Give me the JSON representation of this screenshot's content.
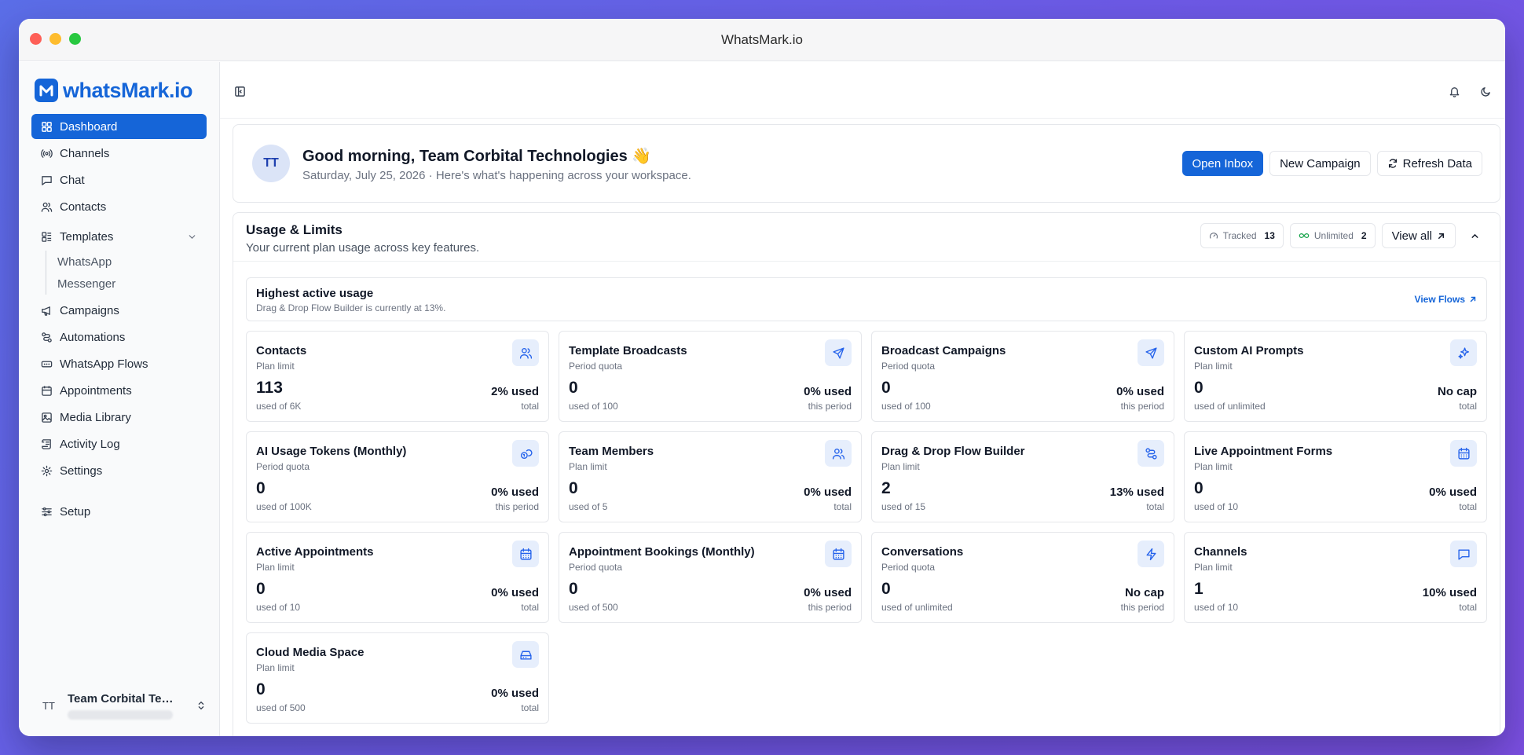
{
  "window": {
    "title": "WhatsMark.io"
  },
  "brand": {
    "name": "whatsMark.io",
    "color": "#1565d8"
  },
  "sidebar": {
    "items": [
      {
        "label": "Dashboard",
        "icon": "grid-icon",
        "active": true
      },
      {
        "label": "Channels",
        "icon": "radio-icon"
      },
      {
        "label": "Chat",
        "icon": "message-icon"
      },
      {
        "label": "Contacts",
        "icon": "users-icon"
      },
      {
        "label": "Templates",
        "icon": "template-icon"
      },
      {
        "label": "Campaigns",
        "icon": "megaphone-icon"
      },
      {
        "label": "Automations",
        "icon": "route-icon"
      },
      {
        "label": "WhatsApp Flows",
        "icon": "rectangle-ellipsis-icon"
      },
      {
        "label": "Appointments",
        "icon": "calendar-icon"
      },
      {
        "label": "Media Library",
        "icon": "image-icon"
      },
      {
        "label": "Activity Log",
        "icon": "scroll-icon"
      },
      {
        "label": "Settings",
        "icon": "gear-icon"
      },
      {
        "label": "Setup",
        "icon": "sliders-icon"
      }
    ],
    "templates_sub": [
      "WhatsApp",
      "Messenger"
    ],
    "user": {
      "initials": "TT",
      "name": "Team Corbital Tec..."
    }
  },
  "greeting": {
    "initials": "TT",
    "title": "Good morning, Team Corbital Technologies 👋",
    "subtitle": "Saturday, July 25, 2026 · Here's what's happening across your workspace.",
    "buttons": {
      "open_inbox": "Open Inbox",
      "new_campaign": "New Campaign",
      "refresh": "Refresh Data"
    }
  },
  "usage": {
    "title": "Usage & Limits",
    "subtitle": "Your current plan usage across key features.",
    "tracked_label": "Tracked",
    "tracked_count": "13",
    "unlimited_label": "Unlimited",
    "unlimited_count": "2",
    "view_all": "View all",
    "highest": {
      "title": "Highest active usage",
      "subtitle": "Drag & Drop Flow Builder is currently at 13%.",
      "link": "View Flows"
    },
    "cards": [
      {
        "title": "Contacts",
        "kind": "Plan limit",
        "value": "113",
        "of": "used of 6K",
        "pct": "2% used",
        "per": "total",
        "icon": "users-icon"
      },
      {
        "title": "Template Broadcasts",
        "kind": "Period quota",
        "value": "0",
        "of": "used of 100",
        "pct": "0% used",
        "per": "this period",
        "icon": "send-icon"
      },
      {
        "title": "Broadcast Campaigns",
        "kind": "Period quota",
        "value": "0",
        "of": "used of 100",
        "pct": "0% used",
        "per": "this period",
        "icon": "send-icon"
      },
      {
        "title": "Custom AI Prompts",
        "kind": "Plan limit",
        "value": "0",
        "of": "used of unlimited",
        "pct": "No cap",
        "per": "total",
        "icon": "sparkles-icon"
      },
      {
        "title": "AI Usage Tokens (Monthly)",
        "kind": "Period quota",
        "value": "0",
        "of": "used of 100K",
        "pct": "0% used",
        "per": "this period",
        "icon": "coins-icon"
      },
      {
        "title": "Team Members",
        "kind": "Plan limit",
        "value": "0",
        "of": "used of 5",
        "pct": "0% used",
        "per": "total",
        "icon": "users-icon"
      },
      {
        "title": "Drag & Drop Flow Builder",
        "kind": "Plan limit",
        "value": "2",
        "of": "used of 15",
        "pct": "13% used",
        "per": "total",
        "icon": "route-icon"
      },
      {
        "title": "Live Appointment Forms",
        "kind": "Plan limit",
        "value": "0",
        "of": "used of 10",
        "pct": "0% used",
        "per": "total",
        "icon": "calendar-icon"
      },
      {
        "title": "Active Appointments",
        "kind": "Plan limit",
        "value": "0",
        "of": "used of 10",
        "pct": "0% used",
        "per": "total",
        "icon": "calendar-icon"
      },
      {
        "title": "Appointment Bookings (Monthly)",
        "kind": "Period quota",
        "value": "0",
        "of": "used of 500",
        "pct": "0% used",
        "per": "this period",
        "icon": "calendar-icon"
      },
      {
        "title": "Conversations",
        "kind": "Period quota",
        "value": "0",
        "of": "used of unlimited",
        "pct": "No cap",
        "per": "this period",
        "icon": "zap-icon"
      },
      {
        "title": "Channels",
        "kind": "Plan limit",
        "value": "1",
        "of": "used of 10",
        "pct": "10% used",
        "per": "total",
        "icon": "message-square-icon"
      },
      {
        "title": "Cloud Media Space",
        "kind": "Plan limit",
        "value": "0",
        "of": "used of 500",
        "pct": "0% used",
        "per": "total",
        "icon": "hard-drive-icon"
      }
    ]
  }
}
